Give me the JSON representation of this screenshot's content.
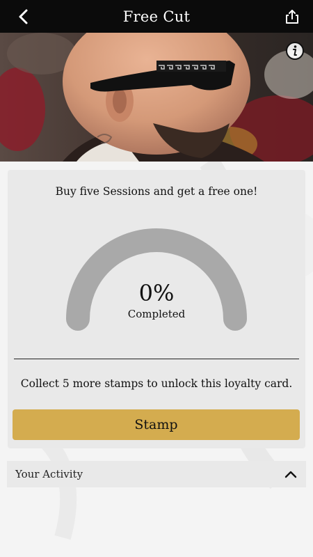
{
  "header": {
    "title": "Free Cut",
    "back_icon": "chevron-left-icon",
    "share_icon": "share-icon"
  },
  "hero": {
    "info_icon": "info-icon"
  },
  "card": {
    "headline": "Buy five Sessions and get a free one!",
    "progress_percent": 0,
    "progress_label": "0%",
    "completed_label": "Completed",
    "unlock_message": "Collect 5 more stamps to unlock this loyalty card.",
    "stamp_label": "Stamp"
  },
  "activity": {
    "label": "Your Activity",
    "toggle_icon": "chevron-up-icon"
  },
  "colors": {
    "topbar": "#0b0b0b",
    "stamp_button": "#d4ac4f",
    "gauge_track": "#a9a9a9",
    "card_bg": "#e9e9e9"
  }
}
